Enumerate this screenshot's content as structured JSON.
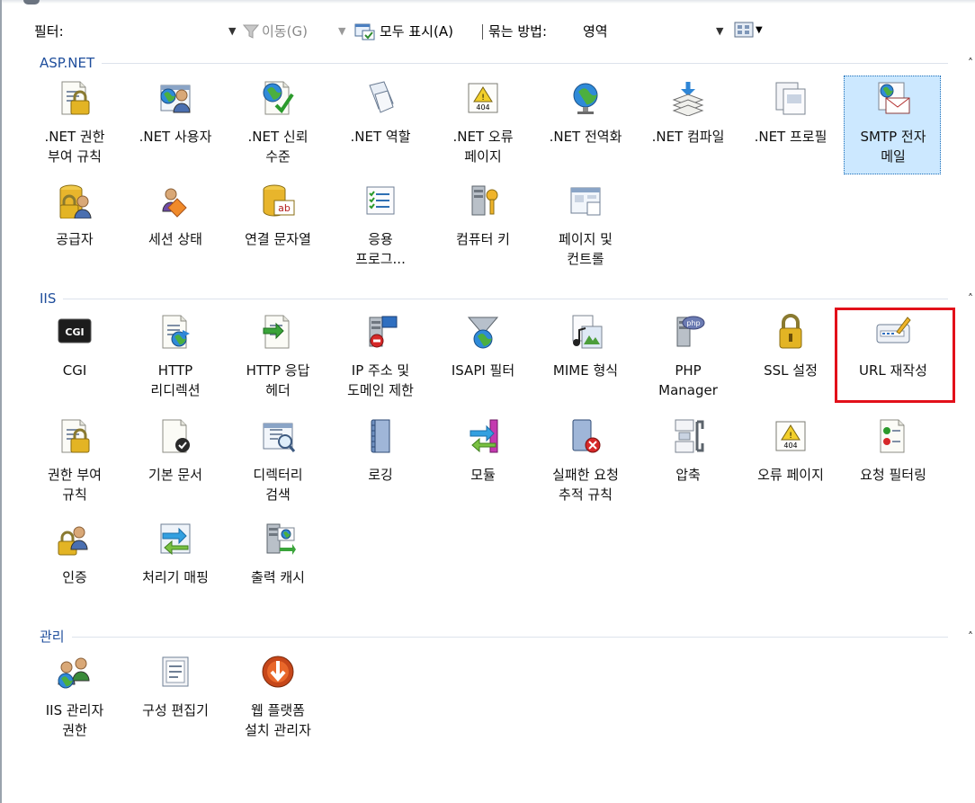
{
  "toolbar": {
    "filter_label": "필터:",
    "filter_value": "",
    "go_label": "이동(G)",
    "show_all_label": "모두 표시(A)",
    "group_by_label": "묶는 방법:",
    "group_by_value": "영역"
  },
  "groups": [
    {
      "title": "ASP.NET",
      "items": [
        {
          "label": ".NET 권한\n부여 규칙",
          "icon": "net-authorization-rules-icon"
        },
        {
          "label": ".NET 사용자",
          "icon": "net-users-icon"
        },
        {
          "label": ".NET 신뢰\n수준",
          "icon": "net-trust-levels-icon"
        },
        {
          "label": ".NET 역할",
          "icon": "net-roles-icon"
        },
        {
          "label": ".NET 오류\n페이지",
          "icon": "net-error-pages-icon"
        },
        {
          "label": ".NET 전역화",
          "icon": "net-globalization-icon"
        },
        {
          "label": ".NET 컴파일",
          "icon": "net-compilation-icon"
        },
        {
          "label": ".NET 프로필",
          "icon": "net-profile-icon"
        },
        {
          "label": "SMTP 전자\n메일",
          "icon": "smtp-email-icon",
          "selected": true
        },
        {
          "label": "공급자",
          "icon": "providers-icon"
        },
        {
          "label": "세션 상태",
          "icon": "session-state-icon"
        },
        {
          "label": "연결 문자열",
          "icon": "connection-strings-icon"
        },
        {
          "label": "응용\n프로그...",
          "icon": "application-settings-icon"
        },
        {
          "label": "컴퓨터 키",
          "icon": "machine-key-icon"
        },
        {
          "label": "페이지 및\n컨트롤",
          "icon": "pages-controls-icon"
        }
      ]
    },
    {
      "title": "IIS",
      "items": [
        {
          "label": "CGI",
          "icon": "cgi-icon"
        },
        {
          "label": "HTTP\n리디렉션",
          "icon": "http-redirect-icon"
        },
        {
          "label": "HTTP 응답\n헤더",
          "icon": "http-response-headers-icon"
        },
        {
          "label": "IP 주소 및\n도메인 제한",
          "icon": "ip-domain-restrictions-icon"
        },
        {
          "label": "ISAPI 필터",
          "icon": "isapi-filters-icon"
        },
        {
          "label": "MIME 형식",
          "icon": "mime-types-icon"
        },
        {
          "label": "PHP\nManager",
          "icon": "php-manager-icon"
        },
        {
          "label": "SSL 설정",
          "icon": "ssl-settings-icon"
        },
        {
          "label": "URL 재작성",
          "icon": "url-rewrite-icon",
          "highlighted": true
        },
        {
          "label": "권한 부여\n규칙",
          "icon": "authorization-rules-icon"
        },
        {
          "label": "기본 문서",
          "icon": "default-document-icon"
        },
        {
          "label": "디렉터리\n검색",
          "icon": "directory-browsing-icon"
        },
        {
          "label": "로깅",
          "icon": "logging-icon"
        },
        {
          "label": "모듈",
          "icon": "modules-icon"
        },
        {
          "label": "실패한 요청\n추적 규칙",
          "icon": "failed-request-tracing-icon"
        },
        {
          "label": "압축",
          "icon": "compression-icon"
        },
        {
          "label": "오류 페이지",
          "icon": "error-pages-icon"
        },
        {
          "label": "요청 필터링",
          "icon": "request-filtering-icon"
        },
        {
          "label": "인증",
          "icon": "authentication-icon"
        },
        {
          "label": "처리기 매핑",
          "icon": "handler-mappings-icon"
        },
        {
          "label": "출력 캐시",
          "icon": "output-caching-icon"
        }
      ]
    },
    {
      "title": "관리",
      "items": [
        {
          "label": "IIS 관리자\n권한",
          "icon": "iis-manager-permissions-icon"
        },
        {
          "label": "구성 편집기",
          "icon": "configuration-editor-icon"
        },
        {
          "label": "웹 플랫폼\n설치 관리자",
          "icon": "web-platform-installer-icon"
        }
      ]
    }
  ],
  "colors": {
    "group_title": "#1f4e9c",
    "selection_fill": "#cce8ff",
    "highlight_border": "#e2101a"
  }
}
